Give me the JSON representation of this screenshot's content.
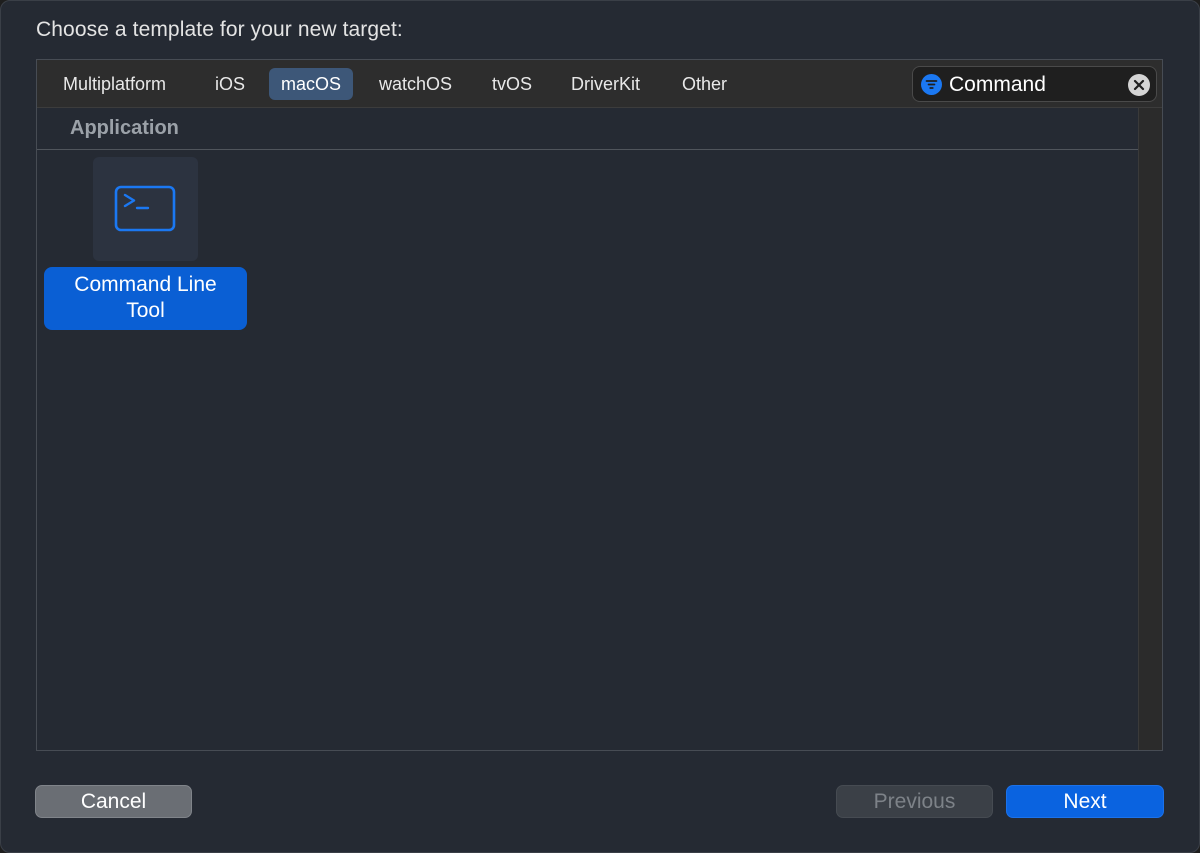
{
  "dialog": {
    "prompt": "Choose a template for your new target:"
  },
  "tabs": [
    {
      "label": "Multiplatform",
      "selected": false
    },
    {
      "label": "iOS",
      "selected": false
    },
    {
      "label": "macOS",
      "selected": true
    },
    {
      "label": "watchOS",
      "selected": false
    },
    {
      "label": "tvOS",
      "selected": false
    },
    {
      "label": "DriverKit",
      "selected": false
    },
    {
      "label": "Other",
      "selected": false
    }
  ],
  "search": {
    "value": "Command",
    "filter_icon": "filter-icon",
    "clear_icon": "clear-icon"
  },
  "section": {
    "title": "Application"
  },
  "templates": [
    {
      "label_line1": "Command Line",
      "label_line2": "Tool",
      "icon": "terminal-icon",
      "selected": true
    }
  ],
  "buttons": {
    "cancel": "Cancel",
    "previous": "Previous",
    "next": "Next"
  },
  "colors": {
    "accent": "#0a63e0",
    "selected_tab": "#3d5778",
    "icon_blue": "#1b78f2"
  }
}
